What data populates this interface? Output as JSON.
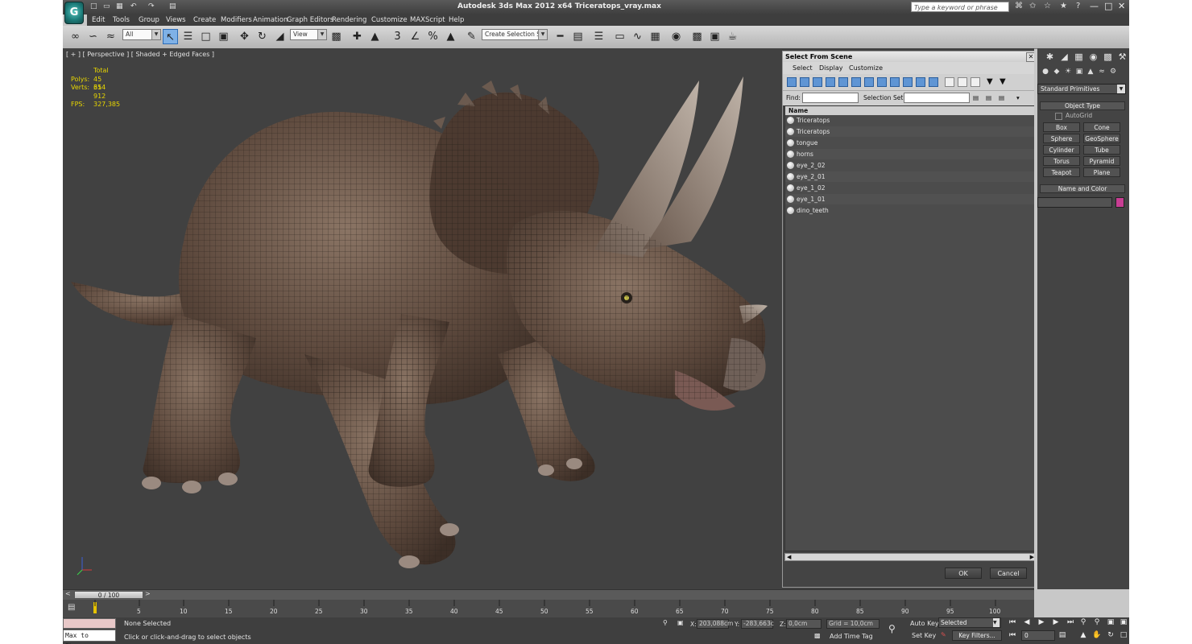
{
  "app": {
    "logo_text": "G",
    "title": "Autodesk 3ds Max  2012 x64     Triceratops_vray.max",
    "search_placeholder": "Type a keyword or phrase"
  },
  "menu": [
    "Edit",
    "Tools",
    "Group",
    "Views",
    "Create",
    "Modifiers",
    "Animation",
    "Graph Editors",
    "Rendering",
    "Customize",
    "MAXScript",
    "Help"
  ],
  "toolbar": {
    "selection_filter": "All",
    "reference_coord": "View",
    "selection_set": "Create Selection Se"
  },
  "viewport": {
    "label": "[ + ] [ Perspective ] [ Shaded + Edged Faces ]",
    "stats": {
      "header": "Total",
      "polys_label": "Polys:",
      "polys_value": "45 654",
      "verts_label": "Verts:",
      "verts_value": "31 912",
      "fps_label": "FPS:",
      "fps_value": "327,385"
    }
  },
  "dialog": {
    "title": "Select From Scene",
    "menu": [
      "Select",
      "Display",
      "Customize"
    ],
    "find_label": "Find:",
    "selection_set_label": "Selection Set:",
    "column_name": "Name",
    "objects": [
      "Triceratops",
      "Triceratops",
      "tongue",
      "horns",
      "eye_2_02",
      "eye_2_01",
      "eye_1_02",
      "eye_1_01",
      "dino_teeth"
    ],
    "ok_label": "OK",
    "cancel_label": "Cancel"
  },
  "command_panel": {
    "category": "Standard Primitives",
    "object_type_label": "Object Type",
    "autogrid_label": "AutoGrid",
    "primitives": [
      "Box",
      "Cone",
      "Sphere",
      "GeoSphere",
      "Cylinder",
      "Tube",
      "Torus",
      "Pyramid",
      "Teapot",
      "Plane"
    ],
    "name_color_label": "Name and Color",
    "object_color": "#c83e93"
  },
  "timeline": {
    "slider_text": "0 / 100",
    "ticks": [
      "5",
      "10",
      "15",
      "20",
      "25",
      "30",
      "35",
      "40",
      "45",
      "50",
      "55",
      "60",
      "65",
      "70",
      "75",
      "80",
      "85",
      "90",
      "95",
      "100"
    ]
  },
  "status": {
    "maxscript_text": "Max to Physc.",
    "selection": "None Selected",
    "prompt": "Click or click-and-drag to select objects",
    "x_label": "X:",
    "x_value": "203,088cm",
    "y_label": "Y:",
    "y_value": "-283,663c",
    "z_label": "Z:",
    "z_value": "0,0cm",
    "grid": "Grid = 10,0cm",
    "add_time_tag": "Add Time Tag",
    "auto_key": "Auto Key",
    "set_key": "Set Key",
    "key_mode": "Selected",
    "key_filters": "Key Filters...",
    "frame": "0"
  }
}
